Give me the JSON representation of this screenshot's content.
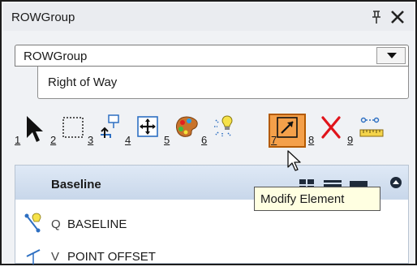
{
  "window": {
    "title": "ROWGroup"
  },
  "group_select": {
    "value": "ROWGroup"
  },
  "category": {
    "value": "Right of Way"
  },
  "toolbar": {
    "tools": [
      {
        "number": "1",
        "icon": "select-arrow-icon"
      },
      {
        "number": "2",
        "icon": "fence-select-icon"
      },
      {
        "number": "3",
        "icon": "place-element-icon"
      },
      {
        "number": "4",
        "icon": "move-element-icon"
      },
      {
        "number": "5",
        "icon": "paint-palette-icon"
      },
      {
        "number": "6",
        "icon": "highlight-elements-icon"
      },
      {
        "number": "7",
        "icon": "modify-element-icon",
        "active": true
      },
      {
        "number": "8",
        "icon": "delete-element-icon"
      },
      {
        "number": "9",
        "icon": "measure-distance-icon"
      }
    ]
  },
  "baseline_panel": {
    "title": "Baseline",
    "items": [
      {
        "code": "Q",
        "name": "BASELINE"
      },
      {
        "code": "V",
        "name": "POINT OFFSET"
      }
    ]
  },
  "tooltip": {
    "text": "Modify Element"
  },
  "colors": {
    "active_tool": "#f4a04a",
    "panel_header": "#dfe9f6",
    "tooltip_bg": "#ffffe1"
  }
}
